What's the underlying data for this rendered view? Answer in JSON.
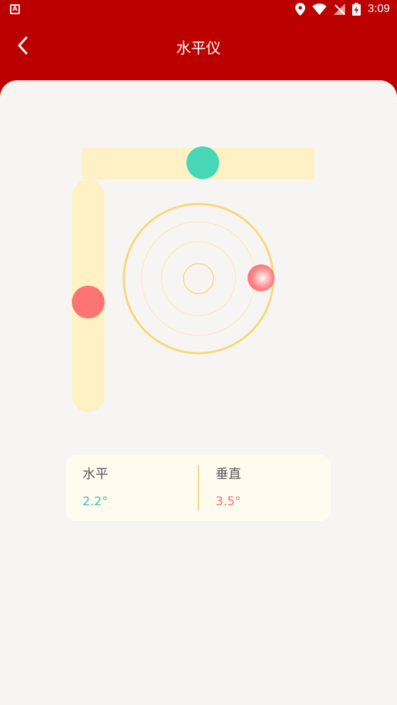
{
  "status_bar": {
    "app_badge": "A",
    "time": "3:09"
  },
  "app_bar": {
    "title": "水平仪"
  },
  "level": {
    "horizontal_label": "水平",
    "horizontal_value": "2.2°",
    "vertical_label": "垂直",
    "vertical_value": "3.5°"
  },
  "colors": {
    "header": "#bc0000",
    "track": "#fef1c4",
    "horizontal_bubble": "#47d6b7",
    "vertical_bubble": "#fe7373",
    "ring": "#f9d776"
  }
}
